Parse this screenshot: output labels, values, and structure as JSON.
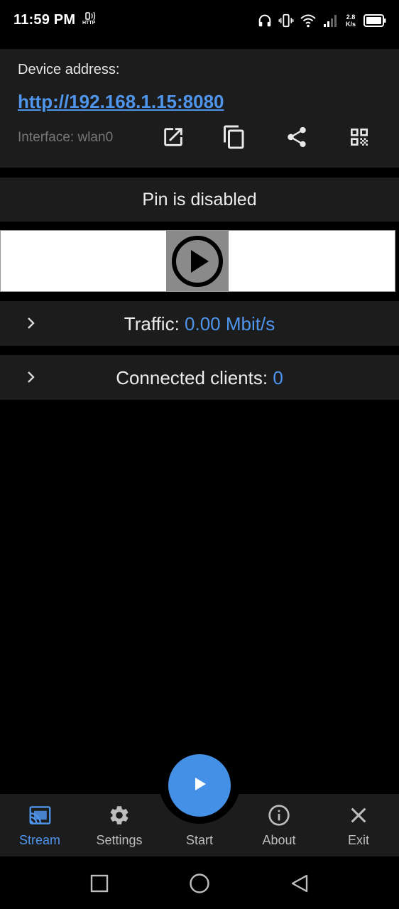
{
  "status_bar": {
    "time": "11:59 PM",
    "http_badge": "HTTP",
    "net_speed_value": "2.8",
    "net_speed_unit": "K/s",
    "icons": [
      "http-cast-icon",
      "headphones-icon",
      "vibrate-icon",
      "wifi-icon",
      "signal-icon",
      "battery-icon"
    ]
  },
  "address_card": {
    "label": "Device address:",
    "url": "http://192.168.1.15:8080",
    "interface": "Interface: wlan0",
    "actions": [
      "open-in-browser-icon",
      "copy-icon",
      "share-icon",
      "qr-code-icon"
    ]
  },
  "pin": {
    "text": "Pin is disabled"
  },
  "preview": {
    "icon": "play-circle-icon"
  },
  "traffic": {
    "label": "Traffic: ",
    "value": "0.00 Mbit/s"
  },
  "clients": {
    "label": "Connected clients: ",
    "value": "0"
  },
  "bottom_nav": {
    "items": [
      {
        "label": "Stream",
        "icon": "cast-icon",
        "active": true
      },
      {
        "label": "Settings",
        "icon": "gear-icon",
        "active": false
      },
      {
        "label": "Start",
        "icon": "play-icon",
        "active": false
      },
      {
        "label": "About",
        "icon": "info-icon",
        "active": false
      },
      {
        "label": "Exit",
        "icon": "close-icon",
        "active": false
      }
    ]
  },
  "colors": {
    "accent": "#4f95ec",
    "fab": "#4390e6",
    "card_bg": "#1c1c1c",
    "page_bg": "#000000"
  }
}
